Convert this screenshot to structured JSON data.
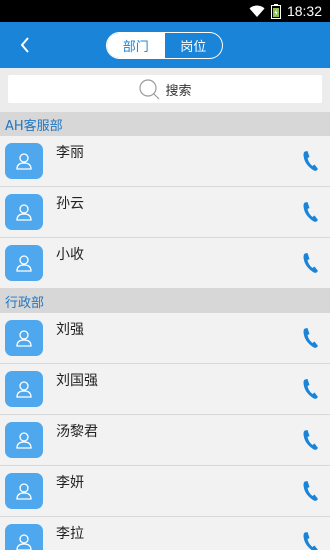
{
  "status_bar": {
    "time": "18:32"
  },
  "tabs": [
    {
      "label": "部门",
      "active": true
    },
    {
      "label": "岗位",
      "active": false
    }
  ],
  "search": {
    "placeholder": "搜索"
  },
  "sections": [
    {
      "title": "AH客服部",
      "contacts": [
        "李丽",
        "孙云",
        "小收"
      ]
    },
    {
      "title": "行政部",
      "contacts": [
        "刘强",
        "刘国强",
        "汤黎君",
        "李妍",
        "李拉"
      ]
    }
  ],
  "colors": {
    "accent": "#1a84d8",
    "avatar": "#4fa8ee",
    "section_text": "#2077c3"
  },
  "icons": {
    "back": "chevron-left-icon",
    "search": "search-icon",
    "avatar": "user-icon",
    "call": "phone-icon"
  }
}
